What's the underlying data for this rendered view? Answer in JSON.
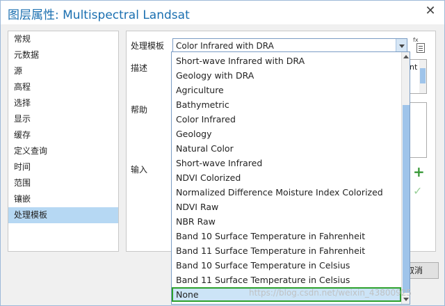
{
  "window": {
    "title": "图层属性: Multispectral Landsat",
    "close_glyph": "✕"
  },
  "nav": {
    "items": [
      "常规",
      "元数据",
      "源",
      "高程",
      "选择",
      "显示",
      "缓存",
      "定义查询",
      "时间",
      "范围",
      "镶嵌",
      "处理模板"
    ],
    "selected_index": 11
  },
  "form": {
    "template_label": "处理模板",
    "template_value": "Color Infrared with DRA",
    "description_label": "描述",
    "description_text_partial": "nt",
    "help_label": "帮助",
    "input_label": "输入",
    "fx_label": "fx"
  },
  "dropdown": {
    "options": [
      "Short-wave Infrared with DRA",
      "Geology with DRA",
      "Agriculture",
      "Bathymetric",
      "Color Infrared",
      "Geology",
      "Natural Color",
      "Short-wave Infrared",
      "NDVI Colorized",
      "Normalized Difference Moisture Index Colorized",
      "NDVI Raw",
      "NBR Raw",
      "Band 10 Surface Temperature in Fahrenheit",
      "Band 11 Surface Temperature in Fahrenheit",
      "Band 10 Surface Temperature in Celsius",
      "Band 11 Surface Temperature in Celsius",
      "None"
    ],
    "highlighted_index": 16
  },
  "buttons": {
    "cancel_label": "取消"
  },
  "icons": {
    "add": "plus-icon",
    "validate": "check-icon",
    "expression": "fx-icon"
  },
  "colors": {
    "accent": "#1a6fb0",
    "selection": "#b6d8f3",
    "highlight_border": "#2ca02c"
  },
  "watermark": "https://blog.csdn.net/weixin_43800925"
}
